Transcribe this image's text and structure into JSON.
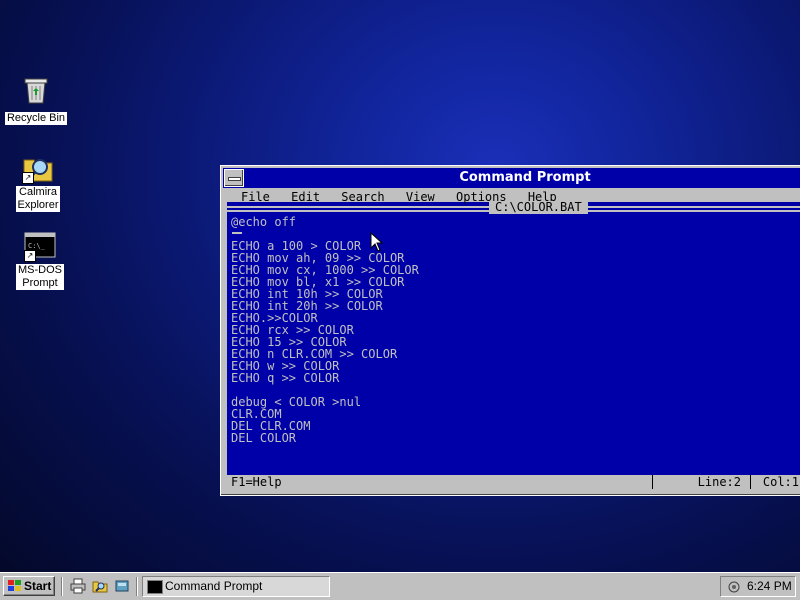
{
  "desktop": {
    "icons": [
      {
        "label": "Recycle Bin",
        "icon": "recycle-bin-icon"
      },
      {
        "label": "Calmira\nExplorer",
        "icon": "explorer-magnifier-icon"
      },
      {
        "label": "MS-DOS\nPrompt",
        "icon": "msdos-prompt-icon"
      }
    ]
  },
  "window": {
    "title": "Command Prompt",
    "menu": [
      "File",
      "Edit",
      "Search",
      "View",
      "Options",
      "Help"
    ],
    "file_name": "C:\\COLOR.BAT",
    "lines": [
      "@echo off",
      "",
      "ECHO a 100 > COLOR",
      "ECHO mov ah, 09 >> COLOR",
      "ECHO mov cx, 1000 >> COLOR",
      "ECHO mov bl, x1 >> COLOR",
      "ECHO int 10h >> COLOR",
      "ECHO int 20h >> COLOR",
      "ECHO.>>COLOR",
      "ECHO rcx >> COLOR",
      "ECHO 15 >> COLOR",
      "ECHO n CLR.COM >> COLOR",
      "ECHO w >> COLOR",
      "ECHO q >> COLOR",
      "",
      "debug < COLOR >nul",
      "CLR.COM",
      "DEL CLR.COM",
      "DEL COLOR"
    ],
    "status": {
      "help": "F1=Help",
      "line": "Line:2",
      "col": "Col:1"
    },
    "colors": {
      "background": "#0000a8",
      "text": "#c0c0c0",
      "titlebar": "#0000a8"
    }
  },
  "taskbar": {
    "start_label": "Start",
    "quick_launch": [
      "printer-icon",
      "folder-search-icon",
      "drive-icon"
    ],
    "task_button": "Command Prompt",
    "clock": "6:24 PM"
  }
}
